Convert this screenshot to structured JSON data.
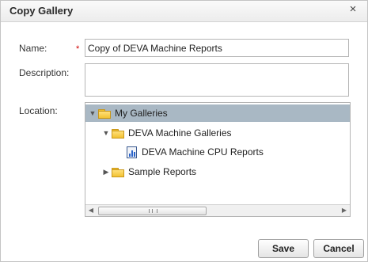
{
  "dialog": {
    "title": "Copy Gallery",
    "close_icon": "×"
  },
  "form": {
    "name_label": "Name:",
    "required_marker": "*",
    "name_value": "Copy of DEVA Machine Reports",
    "description_label": "Description:",
    "description_value": "",
    "location_label": "Location:"
  },
  "tree": {
    "nodes": [
      {
        "label": "My Galleries",
        "type": "folder",
        "expanded": true,
        "selected": true,
        "level": 0
      },
      {
        "label": "DEVA Machine Galleries",
        "type": "folder",
        "expanded": true,
        "selected": false,
        "level": 1
      },
      {
        "label": "DEVA Machine CPU Reports",
        "type": "report",
        "selected": false,
        "level": 2
      },
      {
        "label": "Sample Reports",
        "type": "folder",
        "expanded": false,
        "selected": false,
        "level": 1
      }
    ],
    "expanded_arrow": "▼",
    "collapsed_arrow": "▶",
    "scroll_left": "◀",
    "scroll_right": "▶",
    "selection_color": "#a9b8c4"
  },
  "buttons": {
    "save": "Save",
    "cancel": "Cancel"
  },
  "colors": {
    "required": "#d00000",
    "folder": "#f2c233",
    "report_icon": "#2a63c9"
  }
}
